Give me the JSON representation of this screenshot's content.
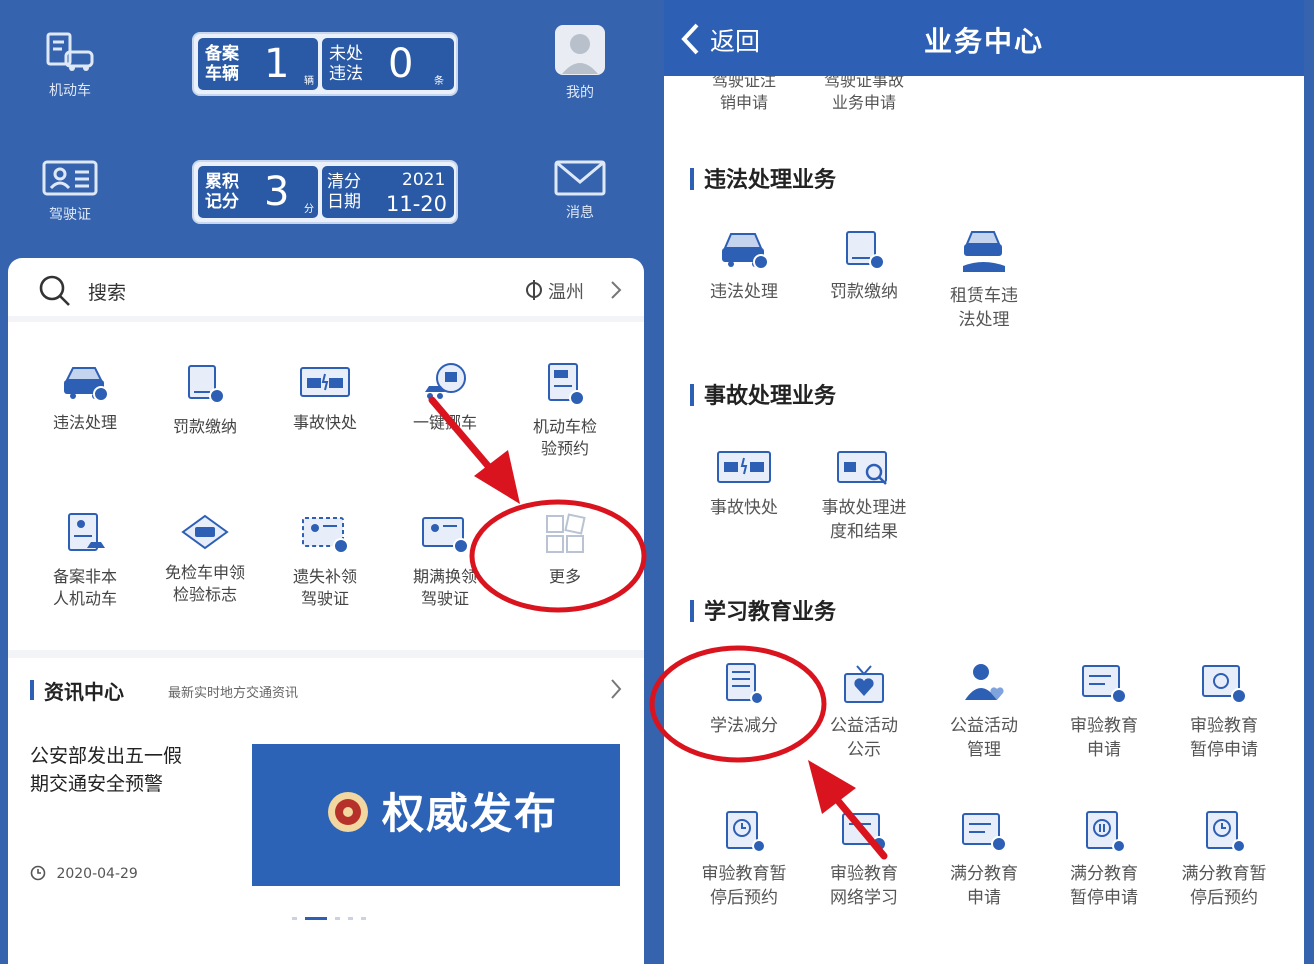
{
  "left": {
    "top_icons": {
      "vehicle": "机动车",
      "license": "驾驶证",
      "mine": "我的",
      "message": "消息"
    },
    "plate1": {
      "label_a": "备案车辆",
      "value_a": "1",
      "unit_a": "辆",
      "label_b": "未处违法",
      "value_b": "0",
      "unit_b": "条"
    },
    "plate2": {
      "label_a": "累积记分",
      "value_a": "3",
      "unit_a": "分",
      "label_b": "清分日期",
      "year_b": "2021",
      "date_b": "11-20"
    },
    "search": {
      "label": "搜索",
      "city": "温州"
    },
    "grid": [
      {
        "line1": "违法处理",
        "line2": ""
      },
      {
        "line1": "罚款缴纳",
        "line2": ""
      },
      {
        "line1": "事故快处",
        "line2": ""
      },
      {
        "line1": "一键挪车",
        "line2": ""
      },
      {
        "line1": "机动车检",
        "line2": "验预约"
      },
      {
        "line1": "备案非本",
        "line2": "人机动车"
      },
      {
        "line1": "免检车申领",
        "line2": "检验标志"
      },
      {
        "line1": "遗失补领",
        "line2": "驾驶证"
      },
      {
        "line1": "期满换领",
        "line2": "驾驶证"
      },
      {
        "line1": "更多",
        "line2": ""
      }
    ],
    "news": {
      "title": "资讯中心",
      "subtitle": "最新实时地方交通资讯",
      "headline_1": "公安部发出五一假",
      "headline_2": "期交通安全预警",
      "date": "2020-04-29",
      "banner_text": "权威发布"
    }
  },
  "right": {
    "back": "返回",
    "title": "业务中心",
    "cut_items": [
      {
        "line1": "驾驶证注",
        "line2": "销申请"
      },
      {
        "line1": "驾驶证事故",
        "line2": "业务申请"
      }
    ],
    "sections": [
      {
        "title": "违法处理业务",
        "items": [
          {
            "line1": "违法处理",
            "line2": ""
          },
          {
            "line1": "罚款缴纳",
            "line2": ""
          },
          {
            "line1": "租赁车违",
            "line2": "法处理"
          }
        ]
      },
      {
        "title": "事故处理业务",
        "items": [
          {
            "line1": "事故快处",
            "line2": ""
          },
          {
            "line1": "事故处理进",
            "line2": "度和结果"
          }
        ]
      },
      {
        "title": "学习教育业务",
        "items": [
          {
            "line1": "学法减分",
            "line2": ""
          },
          {
            "line1": "公益活动",
            "line2": "公示"
          },
          {
            "line1": "公益活动",
            "line2": "管理"
          },
          {
            "line1": "审验教育",
            "line2": "申请"
          },
          {
            "line1": "审验教育",
            "line2": "暂停申请"
          },
          {
            "line1": "审验教育暂",
            "line2": "停后预约"
          },
          {
            "line1": "审验教育",
            "line2": "网络学习"
          },
          {
            "line1": "满分教育",
            "line2": "申请"
          },
          {
            "line1": "满分教育",
            "line2": "暂停申请"
          },
          {
            "line1": "满分教育暂",
            "line2": "停后预约"
          }
        ]
      }
    ]
  },
  "colors": {
    "header_blue": "#3563ad",
    "accent_blue": "#2d5fb5",
    "annotation_red": "#d9141e"
  }
}
